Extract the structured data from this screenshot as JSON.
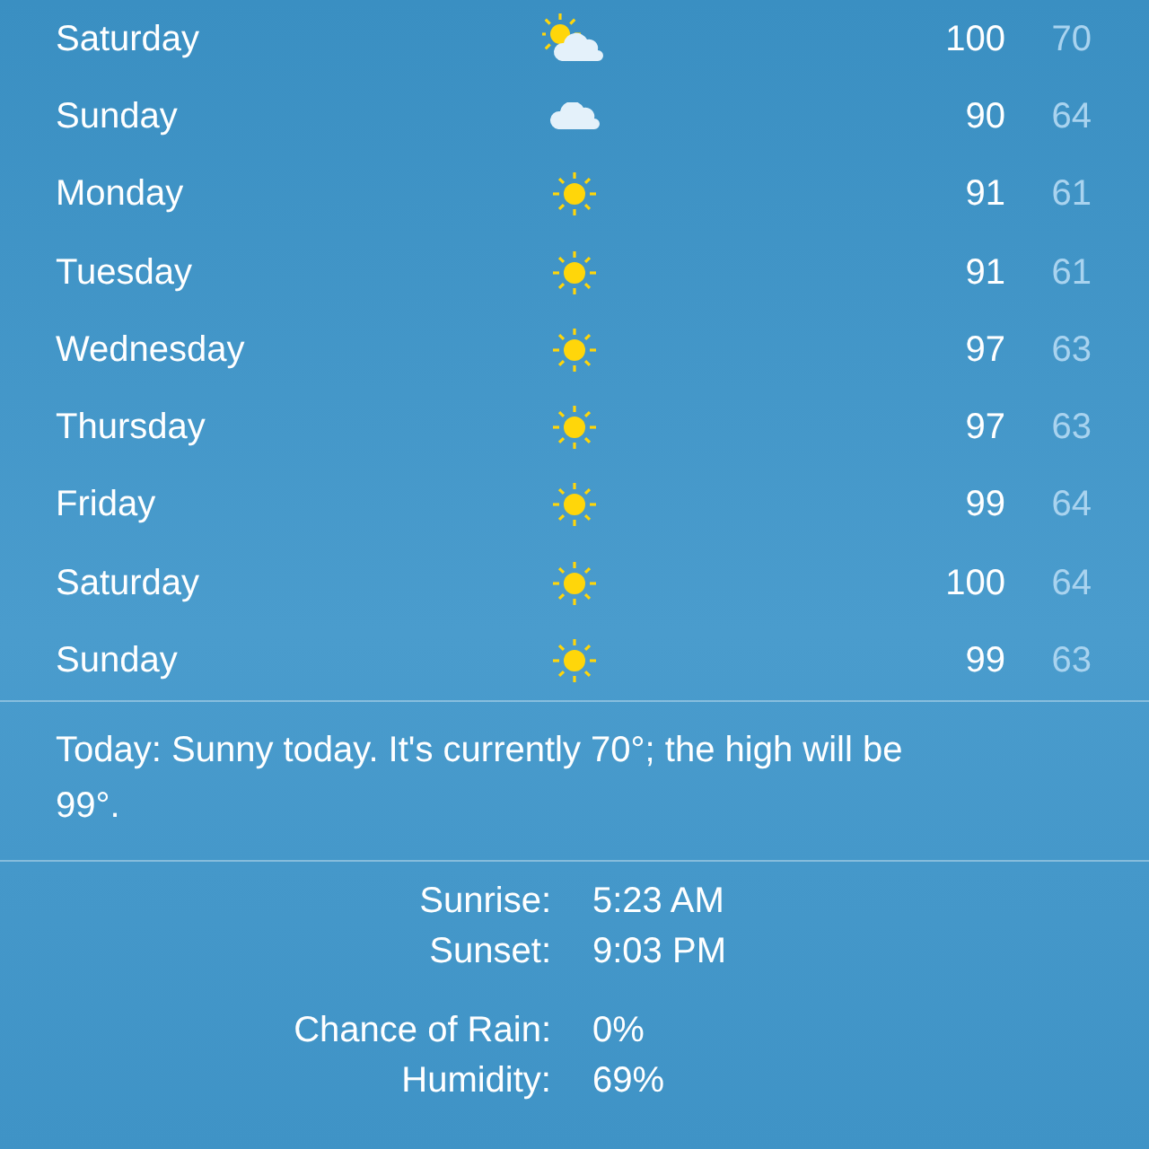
{
  "forecast": [
    {
      "day": "Saturday",
      "kind": "partly-cloudy",
      "high": "100",
      "low": "70"
    },
    {
      "day": "Sunday",
      "kind": "cloudy",
      "high": "90",
      "low": "64"
    },
    {
      "day": "Monday",
      "kind": "sunny",
      "high": "91",
      "low": "61"
    },
    {
      "day": "Tuesday",
      "kind": "sunny",
      "high": "91",
      "low": "61"
    },
    {
      "day": "Wednesday",
      "kind": "sunny",
      "high": "97",
      "low": "63"
    },
    {
      "day": "Thursday",
      "kind": "sunny",
      "high": "97",
      "low": "63"
    },
    {
      "day": "Friday",
      "kind": "sunny",
      "high": "99",
      "low": "64"
    },
    {
      "day": "Saturday",
      "kind": "sunny",
      "high": "100",
      "low": "64"
    },
    {
      "day": "Sunday",
      "kind": "sunny",
      "high": "99",
      "low": "63"
    }
  ],
  "summary": "Today: Sunny today. It's currently 70°; the high will be 99°.",
  "details": [
    [
      {
        "label": "Sunrise:",
        "value": "5:23 AM"
      },
      {
        "label": "Sunset:",
        "value": "9:03 PM"
      }
    ],
    [
      {
        "label": "Chance of Rain:",
        "value": "0%"
      },
      {
        "label": "Humidity:",
        "value": "69%"
      }
    ]
  ]
}
